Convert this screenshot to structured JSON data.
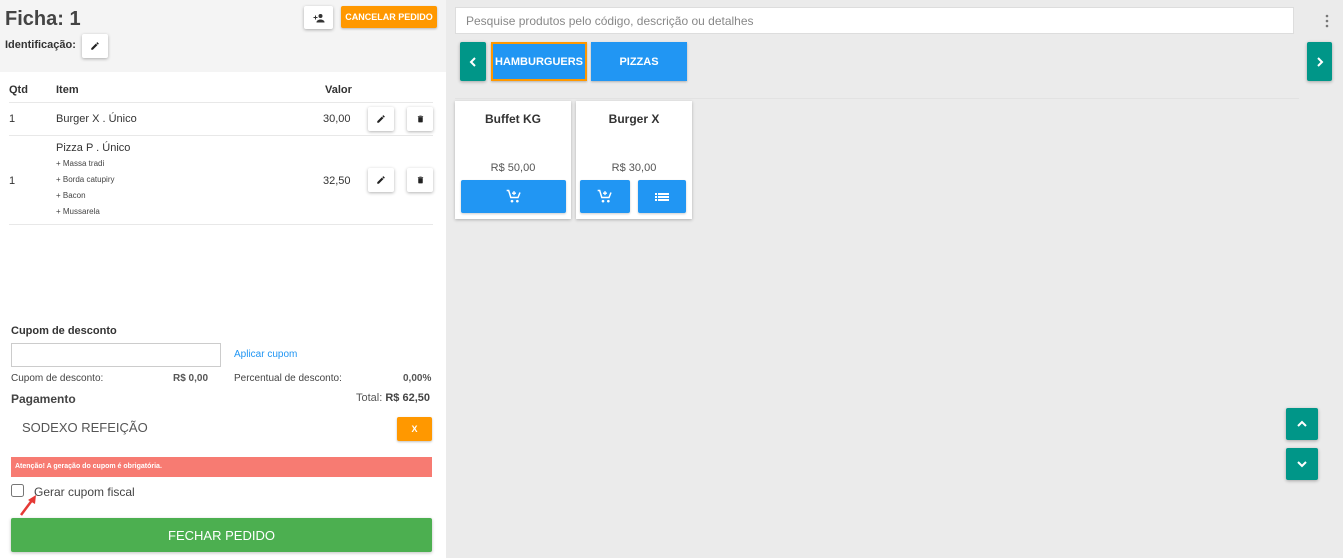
{
  "order": {
    "title": "Ficha: 1",
    "identification_label": "Identificação:",
    "cancel_label": "CANCELAR PEDIDO"
  },
  "table": {
    "headers": {
      "qtd": "Qtd",
      "item": "Item",
      "valor": "Valor"
    },
    "rows": [
      {
        "qtd": "1",
        "item": "Burger X . Único",
        "valor": "30,00",
        "addons": []
      },
      {
        "qtd": "1",
        "item": "Pizza P . Único",
        "valor": "32,50",
        "addons": [
          "+ Massa tradi",
          "+ Borda catupiry",
          "+ Bacon",
          "+ Mussarela"
        ]
      }
    ]
  },
  "coupon": {
    "label": "Cupom de desconto",
    "input_value": "",
    "apply_label": "Aplicar cupom",
    "discount_label": "Cupom de desconto:",
    "discount_value": "R$ 0,00",
    "percent_label": "Percentual de desconto:",
    "percent_value": "0,00%"
  },
  "payment": {
    "title": "Pagamento",
    "total_label": "Total:",
    "total_value": "R$ 62,50",
    "method": "SODEXO REFEIÇÃO",
    "remove_label": "X",
    "alert": "Atenção! A geração do cupom é obrigatória.",
    "fiscal_checkbox_label": "Gerar cupom fiscal",
    "fiscal_checked": false,
    "close_label": "FECHAR PEDIDO"
  },
  "search": {
    "placeholder": "Pesquise produtos pelo código, descrição ou detalhes"
  },
  "categories": [
    {
      "label": "HAMBURGUERS",
      "selected": true
    },
    {
      "label": "PIZZAS",
      "selected": false
    }
  ],
  "products": [
    {
      "name": "Buffet KG",
      "price": "R$ 50,00"
    },
    {
      "name": "Burger X",
      "price": "R$ 30,00"
    }
  ],
  "colors": {
    "primary_blue": "#2196f3",
    "teal": "#009688",
    "orange": "#ff9800",
    "green": "#4caf50",
    "alert_red": "#f77b72"
  },
  "icons": {
    "identification_edit": "pencil-icon",
    "customer": "add-person-icon",
    "row_edit": "pencil-icon",
    "row_delete": "trash-icon",
    "cart_add": "add-cart-icon",
    "details": "list-icon",
    "prev": "chevron-left-icon",
    "next": "chevron-right-icon",
    "scroll_up": "chevron-up-icon",
    "scroll_down": "chevron-down-icon",
    "menu": "more-vert-icon"
  }
}
